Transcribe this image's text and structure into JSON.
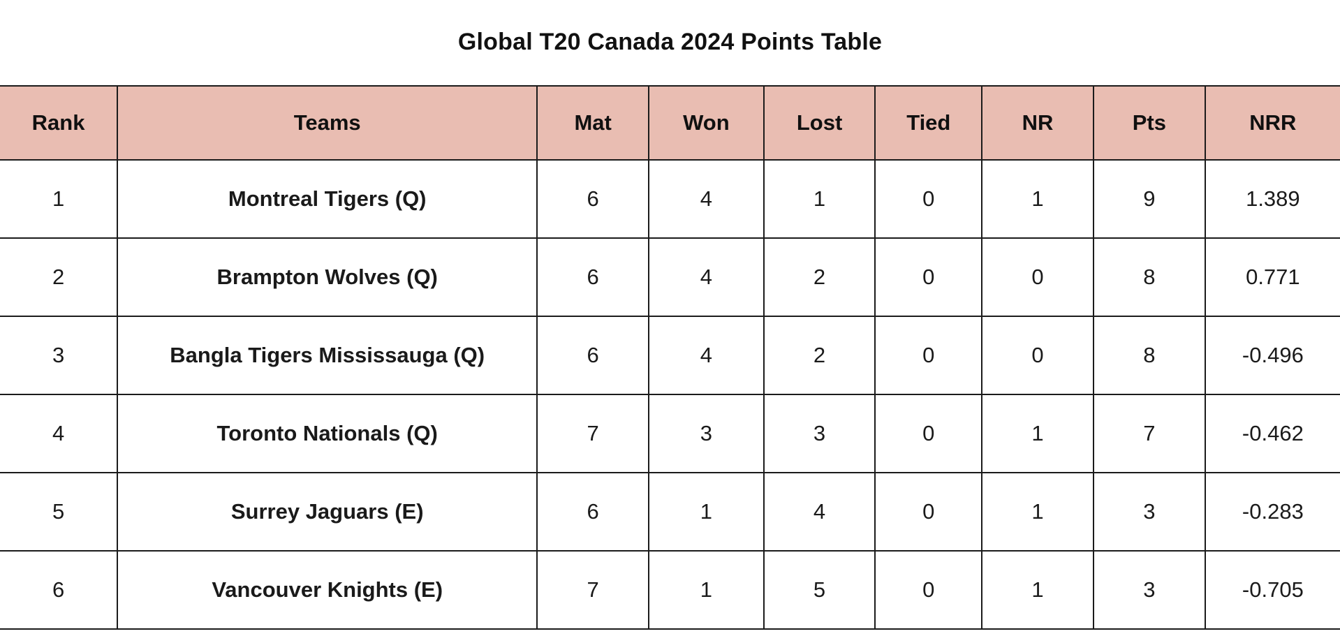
{
  "page": {
    "title": "Global T20 Canada 2024 Points Table",
    "header_bg": "#e9bdb2",
    "border_color": "#1b1b1b"
  },
  "table": {
    "columns": [
      {
        "key": "rank",
        "label": "Rank"
      },
      {
        "key": "teams",
        "label": "Teams"
      },
      {
        "key": "mat",
        "label": "Mat"
      },
      {
        "key": "won",
        "label": "Won"
      },
      {
        "key": "lost",
        "label": "Lost"
      },
      {
        "key": "tied",
        "label": "Tied"
      },
      {
        "key": "nr",
        "label": "NR"
      },
      {
        "key": "pts",
        "label": "Pts"
      },
      {
        "key": "nrr",
        "label": "NRR"
      }
    ],
    "rows": [
      {
        "rank": "1",
        "team": "Montreal Tigers  (Q)",
        "mat": "6",
        "won": "4",
        "lost": "1",
        "tied": "0",
        "nr": "1",
        "pts": "9",
        "nrr": "1.389"
      },
      {
        "rank": "2",
        "team": "Brampton Wolves  (Q)",
        "mat": "6",
        "won": "4",
        "lost": "2",
        "tied": "0",
        "nr": "0",
        "pts": "8",
        "nrr": "0.771"
      },
      {
        "rank": "3",
        "team": "Bangla Tigers Mississauga  (Q)",
        "mat": "6",
        "won": "4",
        "lost": "2",
        "tied": "0",
        "nr": "0",
        "pts": "8",
        "nrr": "-0.496"
      },
      {
        "rank": "4",
        "team": "Toronto Nationals  (Q)",
        "mat": "7",
        "won": "3",
        "lost": "3",
        "tied": "0",
        "nr": "1",
        "pts": "7",
        "nrr": "-0.462"
      },
      {
        "rank": "5",
        "team": "Surrey Jaguars  (E)",
        "mat": "6",
        "won": "1",
        "lost": "4",
        "tied": "0",
        "nr": "1",
        "pts": "3",
        "nrr": "-0.283"
      },
      {
        "rank": "6",
        "team": "Vancouver Knights  (E)",
        "mat": "7",
        "won": "1",
        "lost": "5",
        "tied": "0",
        "nr": "1",
        "pts": "3",
        "nrr": "-0.705"
      }
    ]
  }
}
